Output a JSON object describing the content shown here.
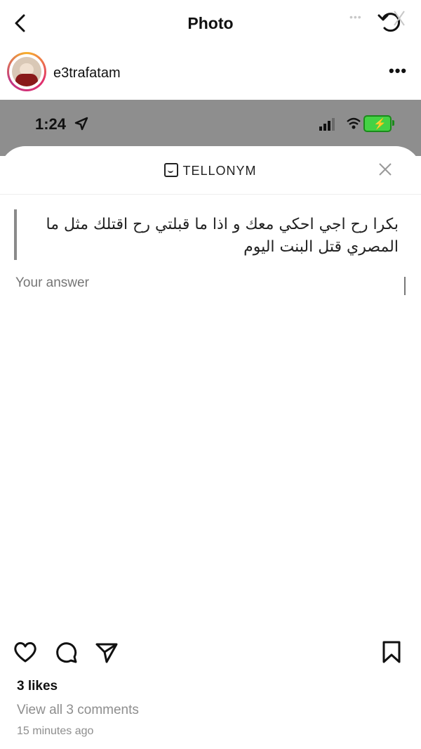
{
  "header": {
    "title": "Photo",
    "back_icon": "chevron-left-icon",
    "rotate_icon": "rotate-icon",
    "overlay_dots": "•••"
  },
  "post": {
    "username": "e3trafatam",
    "more_label": "•••"
  },
  "screenshot": {
    "status_time": "1:24",
    "app_brand": "TELLONYM",
    "question_text": "بكرا رح اجي احكي معك و اذا ما قبلتي رح اقتلك مثل ما المصري قتل البنت اليوم",
    "answer_placeholder": "Your answer",
    "accent_colors": [
      "#2e8cd6",
      "#b236a8",
      "#e6e06a",
      "#f01f77"
    ]
  },
  "footer": {
    "likes": "3 likes",
    "view_comments": "View all 3 comments",
    "time_ago": "15 minutes ago"
  }
}
